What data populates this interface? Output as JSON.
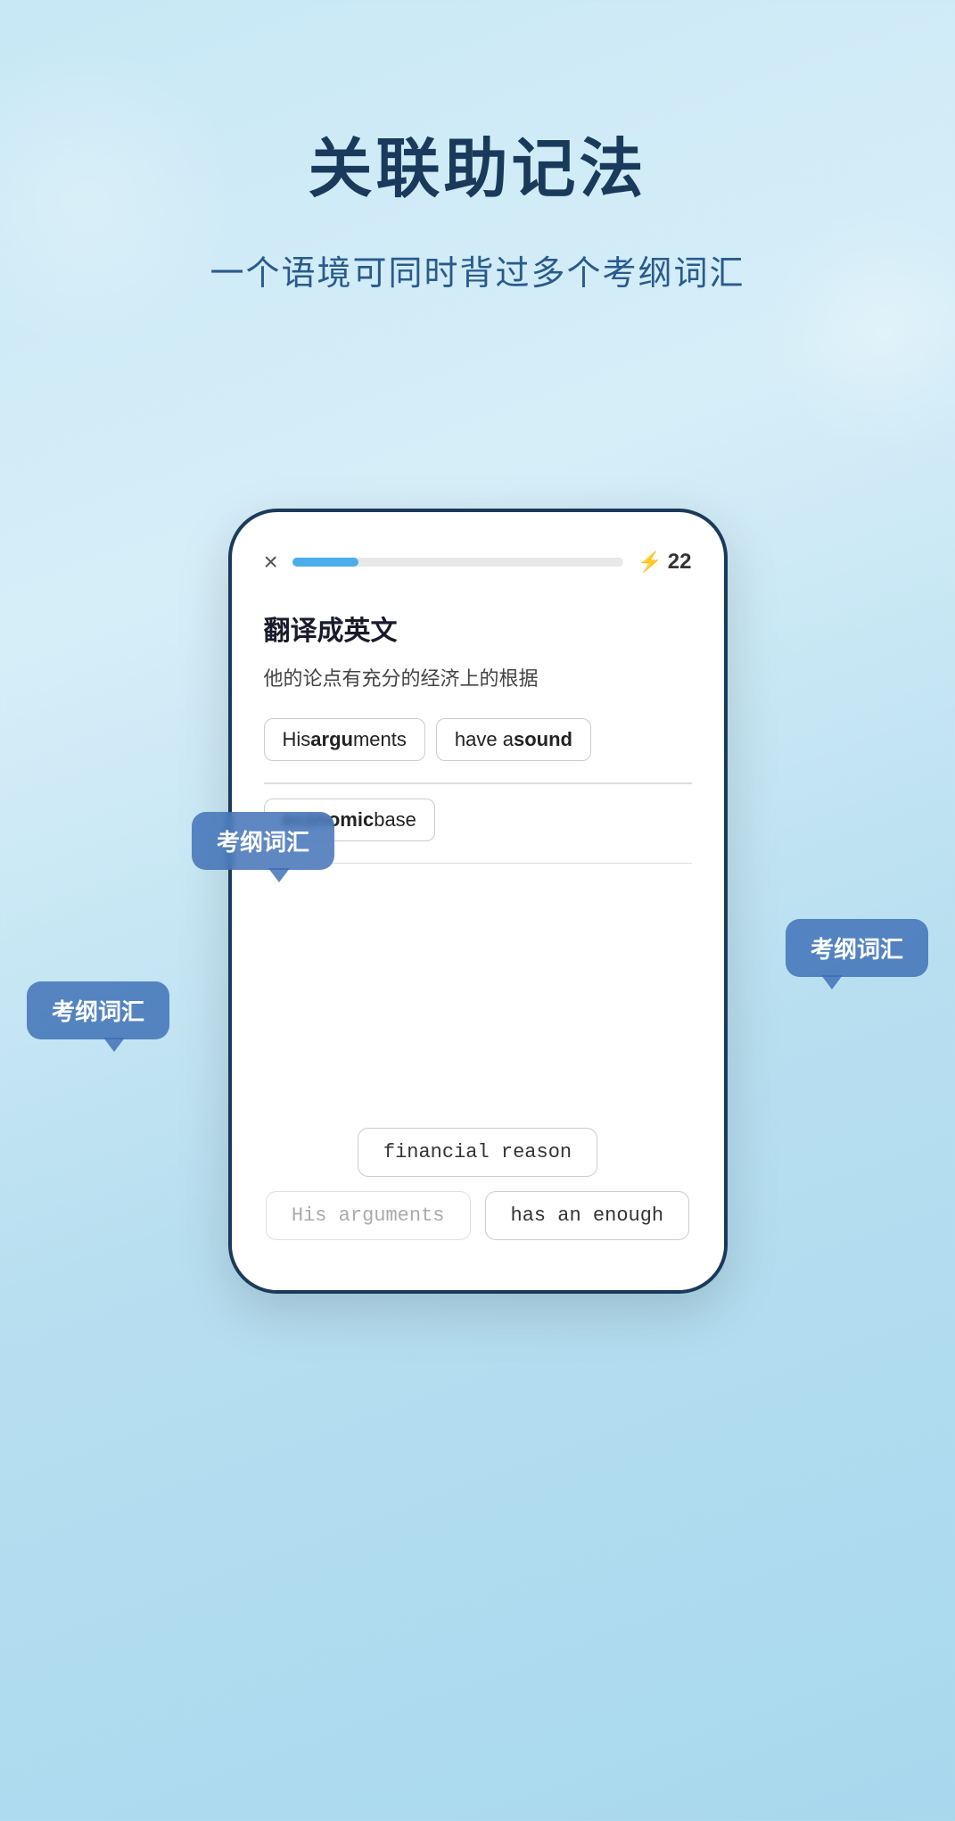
{
  "background": {
    "gradient_start": "#c8e8f5",
    "gradient_end": "#a8d8ee"
  },
  "main_title": "关联助记法",
  "subtitle": "一个语境可同时背过多个考纲词汇",
  "phone": {
    "top_bar": {
      "close_icon": "×",
      "progress_percent": 20,
      "lightning_icon": "⚡",
      "score": "22"
    },
    "instruction": "翻译成英文",
    "chinese_sentence": "他的论点有充分的经济上的根据",
    "answer_line1": {
      "part1": "His ",
      "bold1": "argu",
      "part2": "ments",
      "part3": "    have a ",
      "bold2": "sound"
    },
    "answer_line2": {
      "bold3": "economic",
      "part4": " base"
    },
    "choices": {
      "row1": [
        "financial reason"
      ],
      "row2_dim": "His arguments",
      "row2_normal": "has an enough"
    }
  },
  "tooltips": [
    {
      "id": "tooltip-1",
      "label": "考纲词汇"
    },
    {
      "id": "tooltip-2",
      "label": "考纲词汇"
    },
    {
      "id": "tooltip-3",
      "label": "考纲词汇"
    }
  ]
}
